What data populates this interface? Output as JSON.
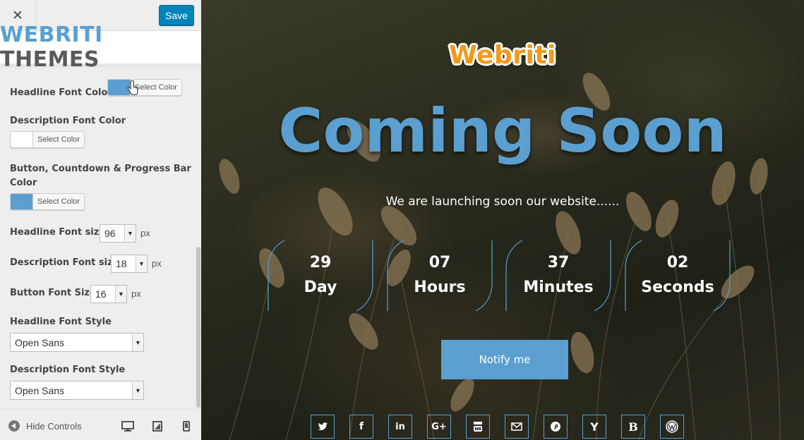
{
  "customizer": {
    "close_glyph": "✕",
    "save_label": "Save",
    "logo": {
      "part1": "WEBRITI",
      "part2": "THEMES"
    },
    "controls": {
      "headline_font_color": {
        "label": "Headline Font Color",
        "button": "Select Color",
        "color": "#5a9fd0"
      },
      "description_font_color": {
        "label": "Description Font Color",
        "button": "Select Color",
        "color": "#ffffff"
      },
      "accent_color": {
        "label": "Button, Countdown & Progress Bar",
        "label2": "Color",
        "button": "Select Color",
        "color": "#5a9fd0"
      },
      "headline_font_size": {
        "label": "Headline Font size",
        "value": "96",
        "unit": "px"
      },
      "description_font_size": {
        "label": "Description Font size",
        "value": "18",
        "unit": "px"
      },
      "button_font_size": {
        "label": "Button Font Size",
        "value": "16",
        "unit": "px"
      },
      "headline_font_style": {
        "label": "Headline Font Style",
        "value": "Open Sans"
      },
      "description_font_style": {
        "label": "Description Font Style",
        "value": "Open Sans"
      }
    },
    "footer": {
      "hide_controls": "Hide Controls"
    }
  },
  "preview": {
    "brand": "Webriti",
    "headline": "Coming Soon",
    "description": "We are launching soon our website......",
    "countdown": [
      {
        "value": "29",
        "label": "Day"
      },
      {
        "value": "07",
        "label": "Hours"
      },
      {
        "value": "37",
        "label": "Minutes"
      },
      {
        "value": "02",
        "label": "Seconds"
      }
    ],
    "notify_label": "Notify me",
    "social": [
      "twitter",
      "facebook",
      "linkedin",
      "google-plus",
      "youtube",
      "email",
      "pinterest",
      "yelp",
      "blogger",
      "wordpress"
    ],
    "social_glyphs": {
      "facebook": "f",
      "linkedin": "in",
      "google_plus": "G+",
      "yelp": "Y",
      "blogger": "B"
    },
    "colors": {
      "accent": "#5a9fd0",
      "brand_orange": "#f39a1a"
    }
  }
}
